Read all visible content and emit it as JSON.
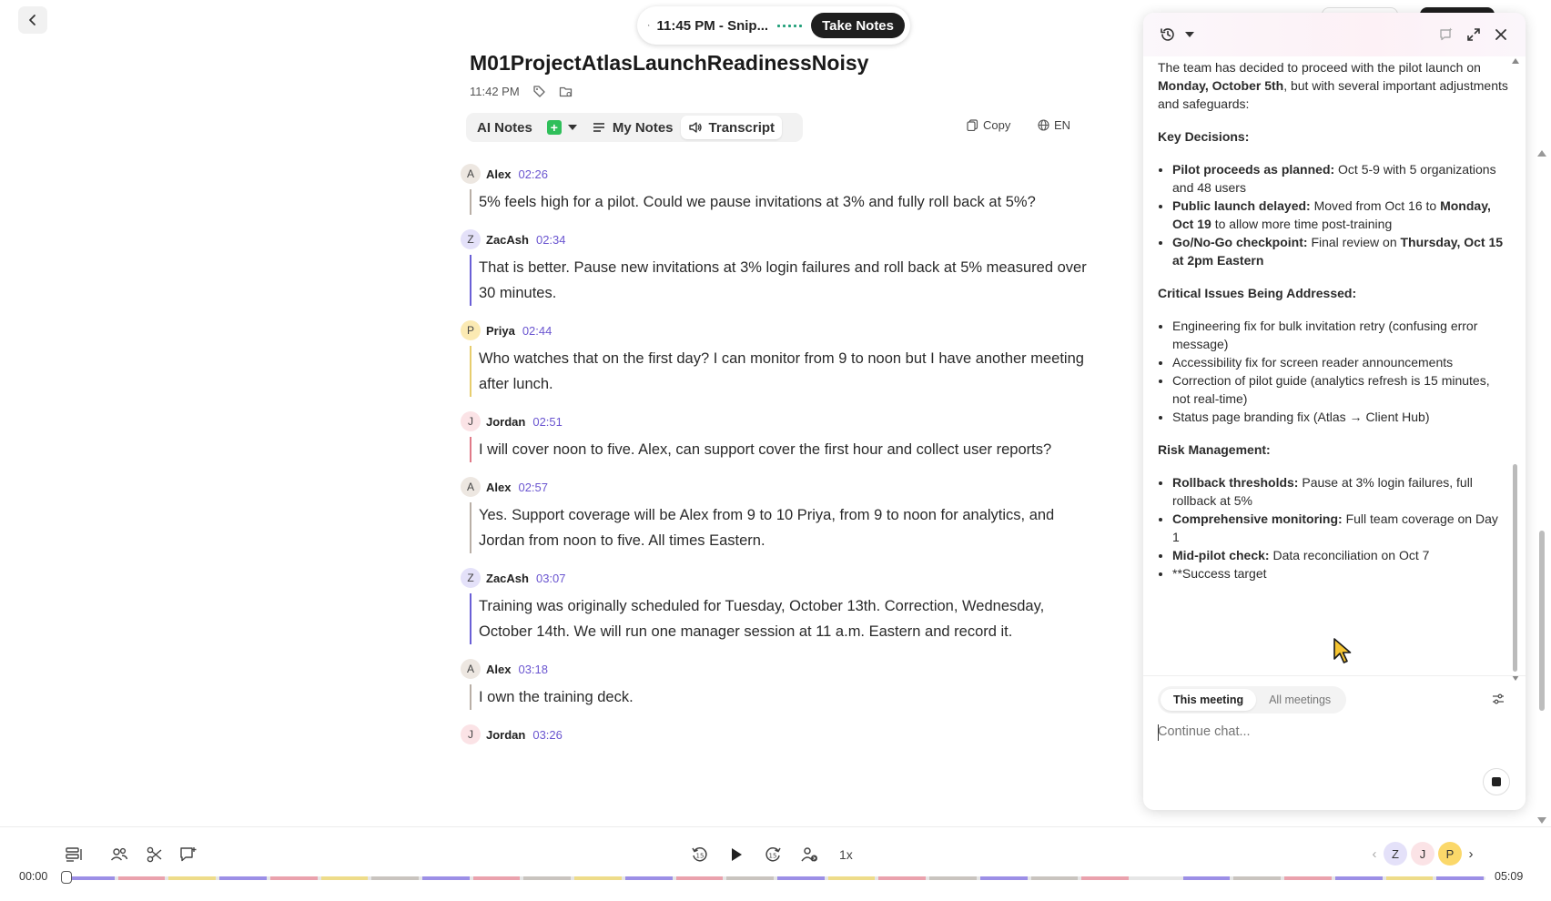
{
  "recording": {
    "label": "11:45 PM - Snip...",
    "take_notes": "Take Notes"
  },
  "meeting": {
    "title": "M01ProjectAtlasLaunchReadinessNoisy",
    "time": "11:42 PM"
  },
  "tabs": {
    "ai_notes": "AI Notes",
    "my_notes": "My Notes",
    "transcript": "Transcript",
    "active": "transcript"
  },
  "toolbar": {
    "copy": "Copy",
    "language": "EN"
  },
  "speakers": {
    "Alex": {
      "initial": "A",
      "bg": "#ede7e1",
      "bar": "#b9afa6"
    },
    "ZacAsh": {
      "initial": "Z",
      "bg": "#e4e1f9",
      "bar": "#6a5fd6"
    },
    "Priya": {
      "initial": "P",
      "bg": "#fbeab3",
      "bar": "#e7cd6e"
    },
    "Jordan": {
      "initial": "J",
      "bg": "#fbe3e6",
      "bar": "#e07a88"
    }
  },
  "transcript": [
    {
      "speaker": "Alex",
      "time": "02:26",
      "text": "5% feels high for a pilot. Could we pause invitations at 3% and fully roll back at 5%?"
    },
    {
      "speaker": "ZacAsh",
      "time": "02:34",
      "text": "That is better. Pause new invitations at 3% login failures and roll back at 5% measured over 30 minutes."
    },
    {
      "speaker": "Priya",
      "time": "02:44",
      "text": "Who watches that on the first day? I can monitor from 9 to noon but I have another meeting after lunch."
    },
    {
      "speaker": "Jordan",
      "time": "02:51",
      "text": "I will cover noon to five. Alex, can support cover the first hour and collect user reports?"
    },
    {
      "speaker": "Alex",
      "time": "02:57",
      "text": "Yes. Support coverage will be Alex from 9 to 10 Priya, from 9 to noon for analytics, and Jordan from noon to five. All times Eastern."
    },
    {
      "speaker": "ZacAsh",
      "time": "03:07",
      "text": "Training was originally scheduled for Tuesday, October 13th. Correction, Wednesday, October 14th. We will run one manager session at 11 a.m. Eastern and record it."
    },
    {
      "speaker": "Alex",
      "time": "03:18",
      "text": "I own the training deck."
    },
    {
      "speaker": "Jordan",
      "time": "03:26",
      "text": ""
    }
  ],
  "chat": {
    "intro_pre": "The team has decided to proceed with the pilot launch on ",
    "intro_bold": "Monday, October 5th",
    "intro_post": ", but with several important adjustments and safeguards:",
    "key_decisions_heading": "Key Decisions:",
    "kd1_bold": "Pilot proceeds as planned:",
    "kd1_text": " Oct 5-9 with 5 organizations and 48 users",
    "kd2_bold": "Public launch delayed:",
    "kd2_text": " Moved from Oct 16 to ",
    "kd2_bold2": "Monday, Oct 19",
    "kd2_text2": " to allow more time post-training",
    "kd3_bold": "Go/No-Go checkpoint:",
    "kd3_text": " Final review on ",
    "kd3_bold2": "Thursday, Oct 15 at 2pm Eastern",
    "critical_heading": "Critical Issues Being Addressed:",
    "ci1": "Engineering fix for bulk invitation retry (confusing error message)",
    "ci2": "Accessibility fix for screen reader announcements",
    "ci3": "Correction of pilot guide (analytics refresh is 15 minutes, not real-time)",
    "ci4": "Status page branding fix (Atlas → Client Hub)",
    "risk_heading": "Risk Management:",
    "rm1_bold": "Rollback thresholds:",
    "rm1_text": " Pause at 3% login failures, full rollback at 5%",
    "rm2_bold": "Comprehensive monitoring:",
    "rm2_text": " Full team coverage on Day 1",
    "rm3_bold": "Mid-pilot check:",
    "rm3_text": " Data reconciliation on Oct 7",
    "rm4": "**Success target",
    "scope_this": "This meeting",
    "scope_all": "All meetings",
    "input_placeholder": "Continue chat..."
  },
  "player": {
    "speed": "1x",
    "time_start": "00:00",
    "time_end": "05:09",
    "participants": [
      {
        "initial": "Z",
        "bg": "#e4e1f9"
      },
      {
        "initial": "J",
        "bg": "#fbe3e6"
      },
      {
        "initial": "P",
        "bg": "#fbd86a"
      }
    ],
    "timeline_colors": [
      "#9c8fe6",
      "#eaa2ad",
      "#eedc8a",
      "#9c8fe6",
      "#eaa2ad",
      "#eedc8a",
      "#c9c4bf",
      "#9c8fe6",
      "#eaa2ad",
      "#c9c4bf",
      "#eedc8a",
      "#9c8fe6",
      "#eaa2ad",
      "#c9c4bf",
      "#9c8fe6",
      "#eedc8a",
      "#eaa2ad",
      "#c9c4bf",
      "#9c8fe6",
      "#c9c4bf",
      "#eaa2ad",
      "#e6e6e6",
      "#9c8fe6",
      "#c9c4bf",
      "#eaa2ad",
      "#9c8fe6",
      "#eedc8a",
      "#9c8fe6"
    ]
  }
}
